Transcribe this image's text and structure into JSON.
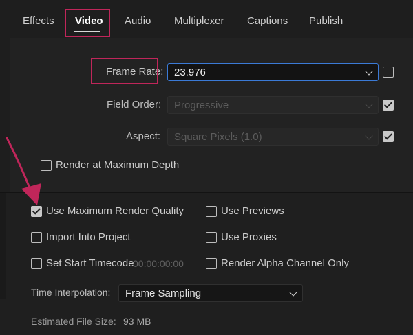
{
  "tabs": [
    {
      "label": "Effects"
    },
    {
      "label": "Video"
    },
    {
      "label": "Audio"
    },
    {
      "label": "Multiplexer"
    },
    {
      "label": "Captions"
    },
    {
      "label": "Publish"
    }
  ],
  "video": {
    "frame_rate": {
      "label": "Frame Rate:",
      "value": "23.976",
      "checked": false
    },
    "field_order": {
      "label": "Field Order:",
      "value": "Progressive",
      "checked": true
    },
    "aspect": {
      "label": "Aspect:",
      "value": "Square Pixels (1.0)",
      "checked": true
    },
    "render_max_depth": {
      "label": "Render at Maximum Depth",
      "checked": false
    }
  },
  "options": {
    "use_max_render_quality": {
      "label": "Use Maximum Render Quality",
      "checked": true
    },
    "use_previews": {
      "label": "Use Previews",
      "checked": false
    },
    "import_into_project": {
      "label": "Import Into Project",
      "checked": false
    },
    "use_proxies": {
      "label": "Use Proxies",
      "checked": false
    },
    "set_start_timecode": {
      "label": "Set Start Timecode",
      "value": "00:00:00:00",
      "checked": false
    },
    "render_alpha_only": {
      "label": "Render Alpha Channel Only",
      "checked": false
    }
  },
  "time_interpolation": {
    "label": "Time Interpolation:",
    "value": "Frame Sampling"
  },
  "estimated_file_size": {
    "label": "Estimated File Size:",
    "value": "93 MB"
  },
  "colors": {
    "highlight": "#c0265a",
    "focus": "#3b7ad6",
    "background": "#1e1e1e"
  }
}
